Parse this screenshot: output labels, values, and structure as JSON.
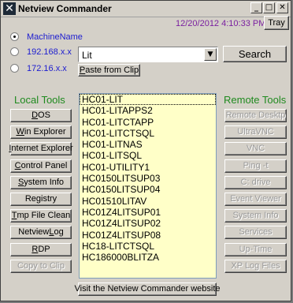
{
  "window": {
    "title": "Netview Commander",
    "datetime": "12/20/2012 4:10:33 PM",
    "tray_label": "Tray",
    "title_buttons": {
      "minimize": "_",
      "restore": "□",
      "close": "✕"
    }
  },
  "target": {
    "options": [
      {
        "label": "MachineName",
        "selected": true
      },
      {
        "label": "192.168.x.x",
        "selected": false
      },
      {
        "label": "172.16.x.x",
        "selected": false
      }
    ],
    "filter_value": "Lit",
    "search_label": "Search",
    "paste_label": "Paste from Clip"
  },
  "local_tools": {
    "heading": "Local Tools",
    "buttons": [
      {
        "label": "DOS",
        "enabled": true
      },
      {
        "label": "Win Explorer",
        "enabled": true
      },
      {
        "label": "Internet Explorer",
        "enabled": true
      },
      {
        "label": "Control Panel",
        "enabled": true
      },
      {
        "label": "System Info",
        "enabled": true
      },
      {
        "label": "Registry",
        "enabled": true
      },
      {
        "label": "Tmp File Clean",
        "enabled": true
      },
      {
        "label": "Netview Log",
        "enabled": true
      },
      {
        "label": "RDP",
        "enabled": true
      },
      {
        "label": "Copy to Clip",
        "enabled": false
      }
    ]
  },
  "remote_tools": {
    "heading": "Remote Tools",
    "buttons": [
      {
        "label": "Remote Desktp",
        "enabled": false
      },
      {
        "label": "UltraVNC",
        "enabled": false
      },
      {
        "label": "VNC",
        "enabled": false
      },
      {
        "label": "Ping -t",
        "enabled": false
      },
      {
        "label": "C: drive",
        "enabled": false
      },
      {
        "label": "Event Viewer",
        "enabled": false
      },
      {
        "label": "System Info",
        "enabled": false
      },
      {
        "label": "Services",
        "enabled": false
      },
      {
        "label": "Up-Time",
        "enabled": false
      },
      {
        "label": "XP Log Files",
        "enabled": false
      }
    ]
  },
  "machines": {
    "items": [
      "HC01-LIT",
      "HC01-LITAPPS2",
      "HC01-LITCTAPP",
      "HC01-LITCTSQL",
      "HC01-LITNAS",
      "HC01-LITSQL",
      "HC01-UTILITY1",
      "HC0150LITSUP03",
      "HC0150LITSUP04",
      "HC01510LITAV",
      "HC01Z4LITSUP01",
      "HC01Z4LITSUP02",
      "HC01Z4LITSUP08",
      "HC18-LITCTSQL",
      "HC186000BLITZA"
    ],
    "selected_index": 0
  },
  "footer": {
    "website_label": "Visit the Netview Commander website"
  },
  "colors": {
    "accent_green": "#1f8a1f",
    "radio_label_blue": "#1c1cd0",
    "datetime_purple": "#7a1fa0",
    "list_bg": "#ffffc8"
  }
}
